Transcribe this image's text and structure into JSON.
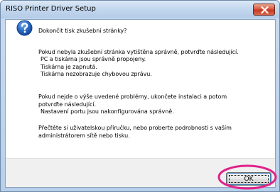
{
  "window": {
    "title": "RISO Printer Driver Setup",
    "close_icon": "close-x-icon"
  },
  "dialog": {
    "icon": "question-icon",
    "heading": "Dokončit tisk zkušební stránky?",
    "paragraph1": {
      "intro": "Pokud nebyla zkušební stránka vytištěna správně, potvrďte následující.",
      "items": [
        "PC a tiskárna jsou správně propojeny.",
        "Tiskárna je zapnutá.",
        "Tiskárna nezobrazuje chybovou zprávu."
      ]
    },
    "paragraph2": {
      "line1": "Pokud nejde o výše uvedené problémy, ukončete instalaci a potom",
      "line2": "potvrďte následující.",
      "item": "Nastavení portu jsou nakonfigurována správně."
    },
    "paragraph3": {
      "line1": "Přečtěte si uživatelskou příručku, nebo proberte podrobnosti s vaším",
      "line2": "administrátorem sítě nebo tisku."
    },
    "ok_label": "OK"
  },
  "colors": {
    "highlight": "#e0218a",
    "question_icon": "#1f5fb5",
    "close_button": "#c9452c"
  }
}
